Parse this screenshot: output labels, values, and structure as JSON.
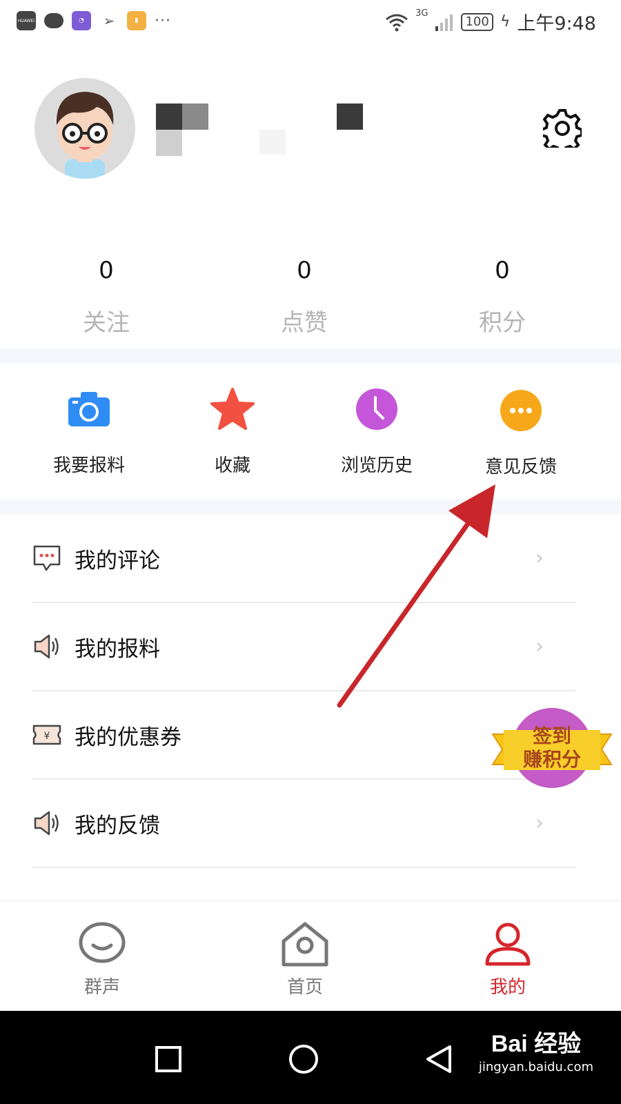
{
  "status_bar": {
    "huawei_label": "HUAWEI",
    "more_icons": "···",
    "network": "3G",
    "battery": "100",
    "time": "上午9:48"
  },
  "profile": {
    "avatar": "cartoon-boy-with-glasses",
    "settings_icon": "gear-icon"
  },
  "stats": [
    {
      "value": "0",
      "label": "关注"
    },
    {
      "value": "0",
      "label": "点赞"
    },
    {
      "value": "0",
      "label": "积分"
    }
  ],
  "quick_actions": [
    {
      "label": "我要报料",
      "icon": "camera-icon",
      "color": "#2f8cf5"
    },
    {
      "label": "收藏",
      "icon": "star-icon",
      "color": "#f25040"
    },
    {
      "label": "浏览历史",
      "icon": "clock-icon",
      "color": "#c556d9"
    },
    {
      "label": "意见反馈",
      "icon": "more-dots-icon",
      "color": "#f7a81a"
    }
  ],
  "menu": [
    {
      "label": "我的评论",
      "icon": "comment-icon"
    },
    {
      "label": "我的报料",
      "icon": "speaker-icon"
    },
    {
      "label": "我的优惠券",
      "icon": "coupon-icon"
    },
    {
      "label": "我的反馈",
      "icon": "speaker-icon"
    }
  ],
  "signin_badge": {
    "line1": "签到",
    "line2": "赚积分"
  },
  "tabs": [
    {
      "label": "群声",
      "icon": "chat-bubble-icon",
      "active": false
    },
    {
      "label": "首页",
      "icon": "home-icon",
      "active": false
    },
    {
      "label": "我的",
      "icon": "person-icon",
      "active": true
    }
  ],
  "watermark": {
    "brand": "Bai 经验",
    "url": "jingyan.baidu.com"
  },
  "colors": {
    "accent": "#d6262b",
    "annotation_arrow": "#c8262a",
    "band": "#f6f7fc"
  }
}
